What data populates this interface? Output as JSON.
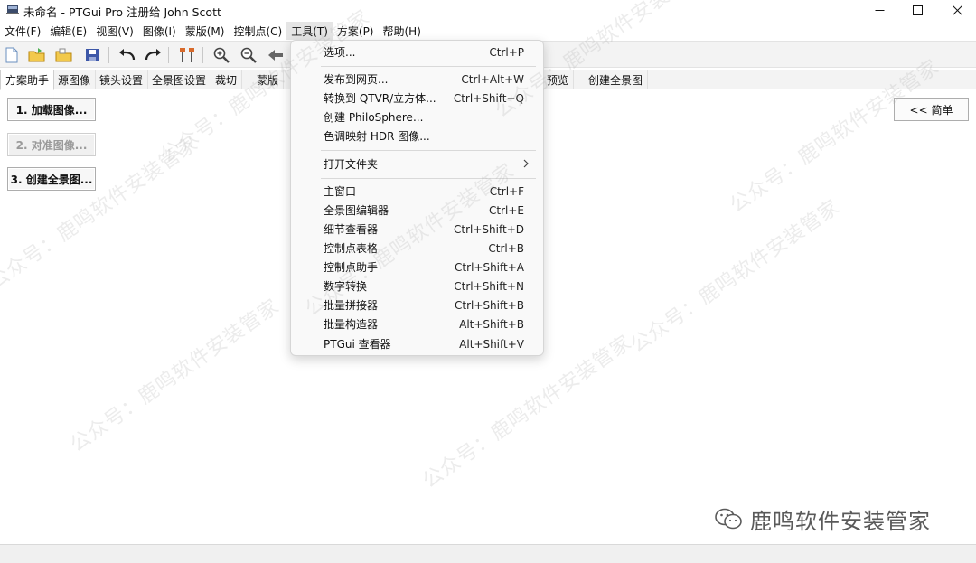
{
  "window": {
    "title": "未命名 - PTGui Pro 注册给 John Scott"
  },
  "menubar": [
    {
      "label": "文件(F)"
    },
    {
      "label": "编辑(E)"
    },
    {
      "label": "视图(V)"
    },
    {
      "label": "图像(I)"
    },
    {
      "label": "蒙版(M)"
    },
    {
      "label": "控制点(C)"
    },
    {
      "label": "工具(T)",
      "active": true
    },
    {
      "label": "方案(P)"
    },
    {
      "label": "帮助(H)"
    }
  ],
  "toolbar": {
    "icons": [
      "new-file-icon",
      "open-folder-icon",
      "open-recent-icon",
      "save-icon",
      "undo-icon",
      "redo-icon",
      "tools-icon",
      "zoom-in-icon",
      "zoom-out-icon",
      "back-arrow-icon"
    ]
  },
  "tabs": [
    {
      "label": "方案助手",
      "active": true
    },
    {
      "label": "源图像"
    },
    {
      "label": "镜头设置"
    },
    {
      "label": "全景图设置"
    },
    {
      "label": "裁切"
    },
    {
      "label": "蒙版"
    },
    {
      "label": "预览"
    },
    {
      "label": "创建全景图"
    }
  ],
  "steps": {
    "load_images": "1. 加载图像...",
    "align_images": "2. 对准图像...",
    "create_panorama": "3. 创建全景图..."
  },
  "simple_button": "<< 简单",
  "tools_menu": {
    "items": [
      {
        "label": "选项...",
        "shortcut": "Ctrl+P"
      },
      {
        "label": "发布到网页...",
        "shortcut": "Ctrl+Alt+W"
      },
      {
        "label": "转换到 QTVR/立方体...",
        "shortcut": "Ctrl+Shift+Q"
      },
      {
        "label": "创建 PhiloSphere...",
        "shortcut": ""
      },
      {
        "label": "色调映射 HDR 图像...",
        "shortcut": ""
      },
      {
        "label": "打开文件夹",
        "shortcut": ""
      },
      {
        "label": "主窗口",
        "shortcut": "Ctrl+F"
      },
      {
        "label": "全景图编辑器",
        "shortcut": "Ctrl+E"
      },
      {
        "label": "细节查看器",
        "shortcut": "Ctrl+Shift+D"
      },
      {
        "label": "控制点表格",
        "shortcut": "Ctrl+B"
      },
      {
        "label": "控制点助手",
        "shortcut": "Ctrl+Shift+A"
      },
      {
        "label": "数字转换",
        "shortcut": "Ctrl+Shift+N"
      },
      {
        "label": "批量拼接器",
        "shortcut": "Ctrl+Shift+B"
      },
      {
        "label": "批量构造器",
        "shortcut": "Alt+Shift+B"
      },
      {
        "label": "PTGui 查看器",
        "shortcut": "Alt+Shift+V"
      }
    ]
  },
  "watermark": {
    "text": "公众号：鹿鸣软件安装管家",
    "brand": "鹿鸣软件安装管家"
  },
  "colors": {
    "menu_active": "#e5e5e5",
    "toolbar_bg": "#f3f3f3",
    "dropdown_bg": "#f9f9f9"
  }
}
